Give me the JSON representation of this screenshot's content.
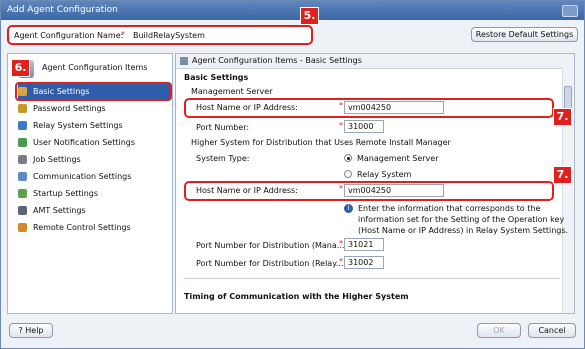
{
  "window": {
    "title": "Add Agent Configuration"
  },
  "name_bar": {
    "label": "Agent Configuration Name:",
    "required_mark": "*",
    "value": "BuildRelaySystem",
    "restore_button": "Restore Default Settings"
  },
  "callouts": {
    "c5": "5.",
    "c6": "6.",
    "c7a": "7.",
    "c7b": "7."
  },
  "sidebar": {
    "title": "Agent Configuration Items",
    "items": [
      {
        "label": "Basic Settings",
        "icon": "basic-settings-icon",
        "selected": true
      },
      {
        "label": "Password Settings",
        "icon": "password-icon"
      },
      {
        "label": "Relay System Settings",
        "icon": "relay-system-icon"
      },
      {
        "label": "User Notification Settings",
        "icon": "user-notification-icon"
      },
      {
        "label": "Job Settings",
        "icon": "job-icon"
      },
      {
        "label": "Communication Settings",
        "icon": "communication-icon"
      },
      {
        "label": "Startup Settings",
        "icon": "startup-icon"
      },
      {
        "label": "AMT Settings",
        "icon": "amt-icon"
      },
      {
        "label": "Remote Control Settings",
        "icon": "remote-control-icon"
      }
    ]
  },
  "panel": {
    "header": "Agent Configuration Items - Basic Settings",
    "section_title": "Basic Settings",
    "management_server": "Management Server",
    "host_label": "Host Name or IP Address:",
    "host_value": "vm004250",
    "port_label": "Port Number:",
    "port_value": "31000",
    "higher_system_title": "Higher System for Distribution that Uses Remote Install Manager",
    "system_type_label": "System Type:",
    "opt_management": "Management Server",
    "opt_relay": "Relay System",
    "host2_label": "Host Name or IP Address:",
    "host2_value": "vm004250",
    "info_text_1": "Enter the information that corresponds to the",
    "info_text_2": "information set for the Setting of the Operation key",
    "info_text_3": "(Host Name or IP Address) in Relay System Settings.",
    "port_dist_mana_label": "Port Number for Distribution (Mana...",
    "port_dist_mana_value": "31021",
    "port_dist_relay_label": "Port Number for Distribution (Relay...",
    "port_dist_relay_value": "31002",
    "timing_title": "Timing of Communication with the Higher System"
  },
  "footer": {
    "help": "Help",
    "ok": "OK",
    "cancel": "Cancel"
  },
  "colors": {
    "accent": "#2e5ea9",
    "callout": "#e0201d",
    "title_bar": "#4a73b0"
  }
}
